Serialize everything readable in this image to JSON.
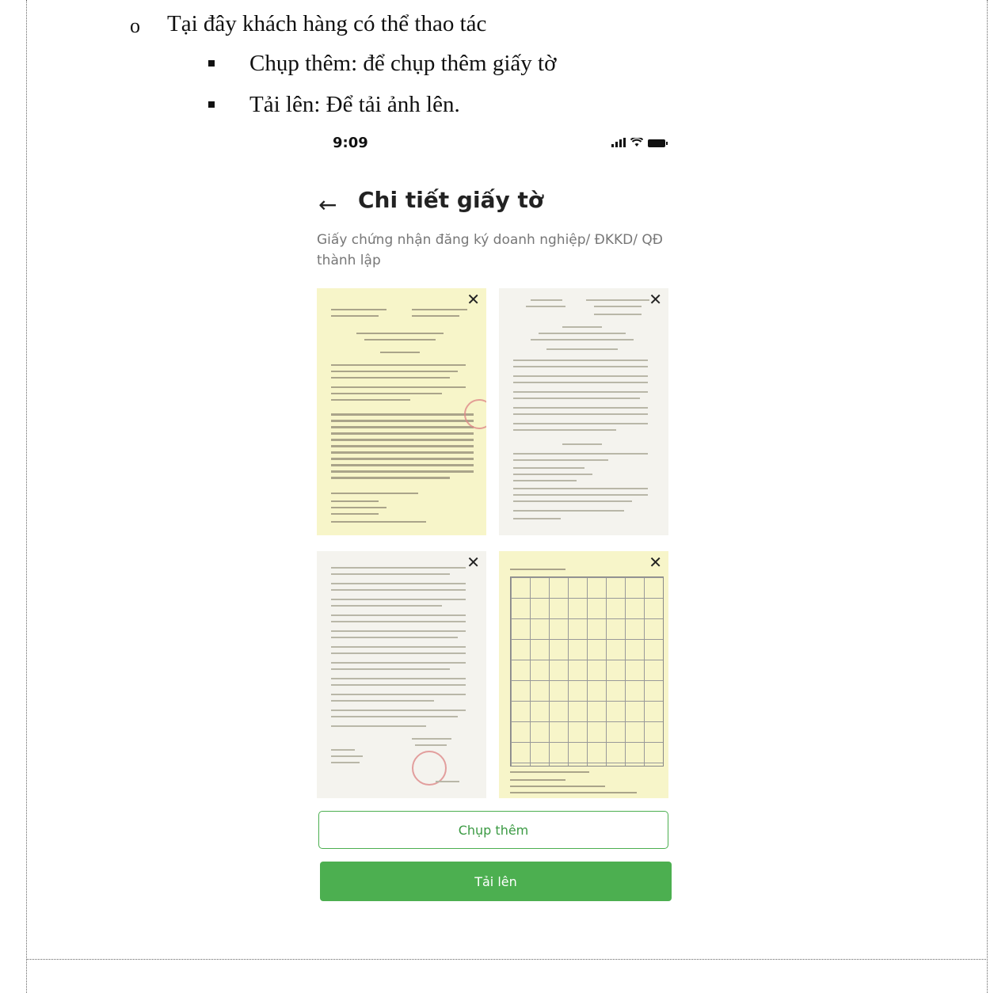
{
  "doc": {
    "line1": "Tại đây khách hàng có thể thao tác",
    "bullet1": "Chụp thêm: để chụp thêm giấy tờ",
    "bullet2": "Tải lên: Để tải ảnh lên."
  },
  "phone": {
    "time": "9:09",
    "back_icon": "arrow-left-icon",
    "title": "Chi tiết giấy tờ",
    "subtitle": "Giấy chứng nhận đăng ký doanh nghiệp/ ĐKKD/ QĐ thành lập",
    "close_glyph": "✕",
    "buttons": {
      "capture_more": "Chụp thêm",
      "upload": "Tải lên"
    },
    "colors": {
      "accent": "#4caf50",
      "thumb_yellow": "#f7f5c9",
      "thumb_gray": "#f4f3ee"
    }
  }
}
